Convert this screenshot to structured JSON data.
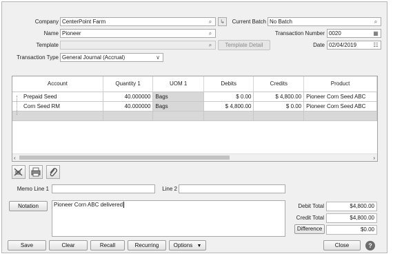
{
  "header": {
    "company_label": "Company",
    "company_value": "CenterPoint Farm",
    "current_batch_label": "Current Batch",
    "current_batch_value": "No Batch",
    "name_label": "Name",
    "name_value": "Pioneer",
    "transaction_number_label": "Transaction Number",
    "transaction_number_value": "0020",
    "template_label": "Template",
    "template_value": "",
    "template_detail_label": "Template Detail",
    "date_label": "Date",
    "date_value": "02/04/2019",
    "transaction_type_label": "Transaction Type",
    "transaction_type_value": "General Journal (Accrual)"
  },
  "grid": {
    "columns": [
      "Account",
      "Quantity 1",
      "UOM 1",
      "Debits",
      "Credits",
      "Product"
    ],
    "rows": [
      [
        "Prepaid Seed",
        "40.000000",
        "Bags",
        "$ 0.00",
        "$ 4,800.00",
        "Pioneer Corn Seed ABC"
      ],
      [
        "Corn Seed RM",
        "40.000000",
        "Bags",
        "$ 4,800.00",
        "$ 0.00",
        "Pioneer Corn Seed ABC"
      ]
    ]
  },
  "memo": {
    "memo_line1_label": "Memo Line 1",
    "memo_line1_value": "",
    "line2_label": "Line 2",
    "line2_value": ""
  },
  "notation": {
    "button_label": "Notation",
    "text": "Pioneer Corn ABC delivered"
  },
  "totals": {
    "debit_total_label": "Debit Total",
    "debit_total_value": "$4,800.00",
    "credit_total_label": "Credit Total",
    "credit_total_value": "$4,800.00",
    "difference_label": "Difference",
    "difference_value": "$0.00"
  },
  "footer": {
    "save": "Save",
    "clear": "Clear",
    "recall": "Recall",
    "recurring": "Recurring",
    "options": "Options",
    "close": "Close",
    "help": "?"
  },
  "icons": {
    "lookup": "magnifier-icon",
    "batch": "batch-arrow-icon",
    "calendar": "calendar-icon"
  },
  "colors": {
    "window_bg": "#f0f0f0",
    "grid_gray_cell": "#d8d8d8"
  }
}
